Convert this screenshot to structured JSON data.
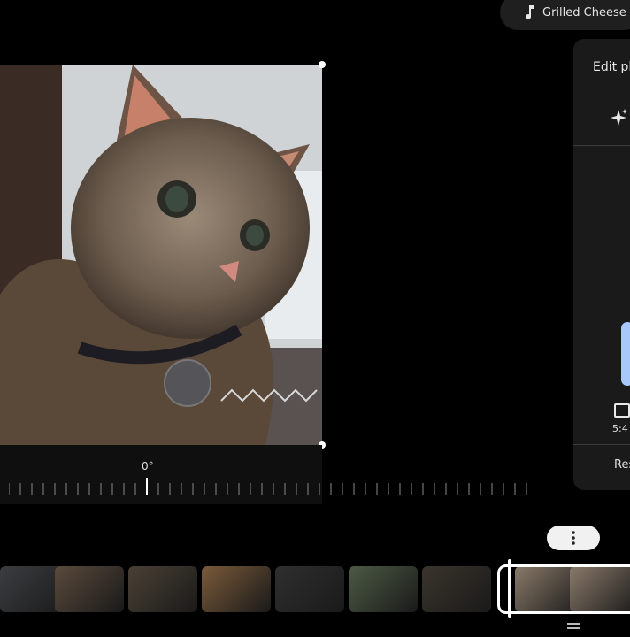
{
  "music": {
    "title": "Grilled Cheese",
    "icon": "music-note-icon"
  },
  "editor": {
    "rotation_angle": "0°"
  },
  "edit_panel": {
    "title": "Edit photo",
    "aspect_ratio": "5:4",
    "reset_label": "Reset"
  },
  "icons": {
    "sparkle": "sparkle-icon",
    "more": "more-vert-icon",
    "handle": "drag-handle-icon"
  },
  "filmstrip": {
    "thumbnails": [
      {
        "name": "thumb-1",
        "color": "#3b3d40"
      },
      {
        "name": "thumb-2",
        "color": "#5a4a3c"
      },
      {
        "name": "thumb-3",
        "color": "#4a4135"
      },
      {
        "name": "thumb-4",
        "color": "#7a5a3a"
      },
      {
        "name": "thumb-5",
        "color": "#2f2f30"
      },
      {
        "name": "thumb-6",
        "color": "#4d5a45"
      },
      {
        "name": "thumb-7",
        "color": "#3a342c"
      },
      {
        "name": "thumb-8-selected",
        "color": "#8a7a6a"
      },
      {
        "name": "thumb-9-selected",
        "color": "#8a7a6a"
      }
    ]
  }
}
